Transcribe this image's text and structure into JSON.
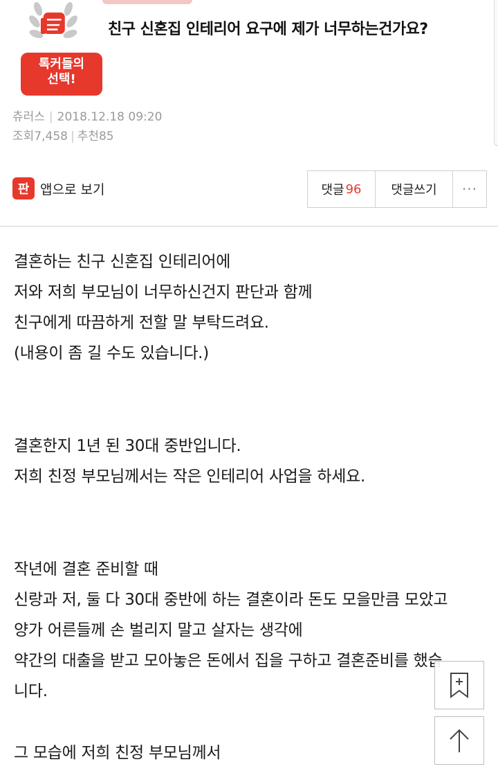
{
  "badge": {
    "line1": "톡커들의",
    "line2": "선택!"
  },
  "post": {
    "title": "친구 신혼집 인테리어 요구에 제가 너무하는건가요?",
    "author": "츄러스",
    "datetime": "2018.12.18 09:20",
    "views_label": "조회",
    "views": "7,458",
    "recommend_label": "추천",
    "recommend": "85"
  },
  "actions": {
    "app_icon_text": "판",
    "app_view_label": "앱으로 보기",
    "comments_label": "댓글",
    "comments_count": "96",
    "write_comment_label": "댓글쓰기",
    "more_label": "···"
  },
  "content": {
    "block1": [
      "결혼하는 친구 신혼집 인테리어에",
      "저와 저희 부모님이 너무하신건지 판단과 함께",
      "친구에게 따끔하게 전할 말 부탁드려요.",
      "(내용이 좀 길 수도 있습니다.)"
    ],
    "block2": [
      "결혼한지 1년 된 30대 중반입니다.",
      "저희 친정 부모님께서는 작은 인테리어 사업을 하세요."
    ],
    "block3": [
      "작년에 결혼 준비할 때",
      "신랑과 저, 둘 다 30대 중반에 하는 결혼이라 돈도 모을만큼 모았고",
      "양가 어른들께 손 벌리지 말고 살자는 생각에",
      "약간의 대출을 받고 모아놓은 돈에서 집을 구하고 결혼준비를 했습",
      "니다."
    ],
    "block4": [
      "그 모습에 저희 친정 부모님께서"
    ]
  },
  "icons": {
    "bookmark": "bookmark-add-icon",
    "top": "arrow-up-icon"
  },
  "colors": {
    "accent": "#e7382c",
    "meta": "#9a9a9a",
    "divider": "#d4d4d4"
  }
}
